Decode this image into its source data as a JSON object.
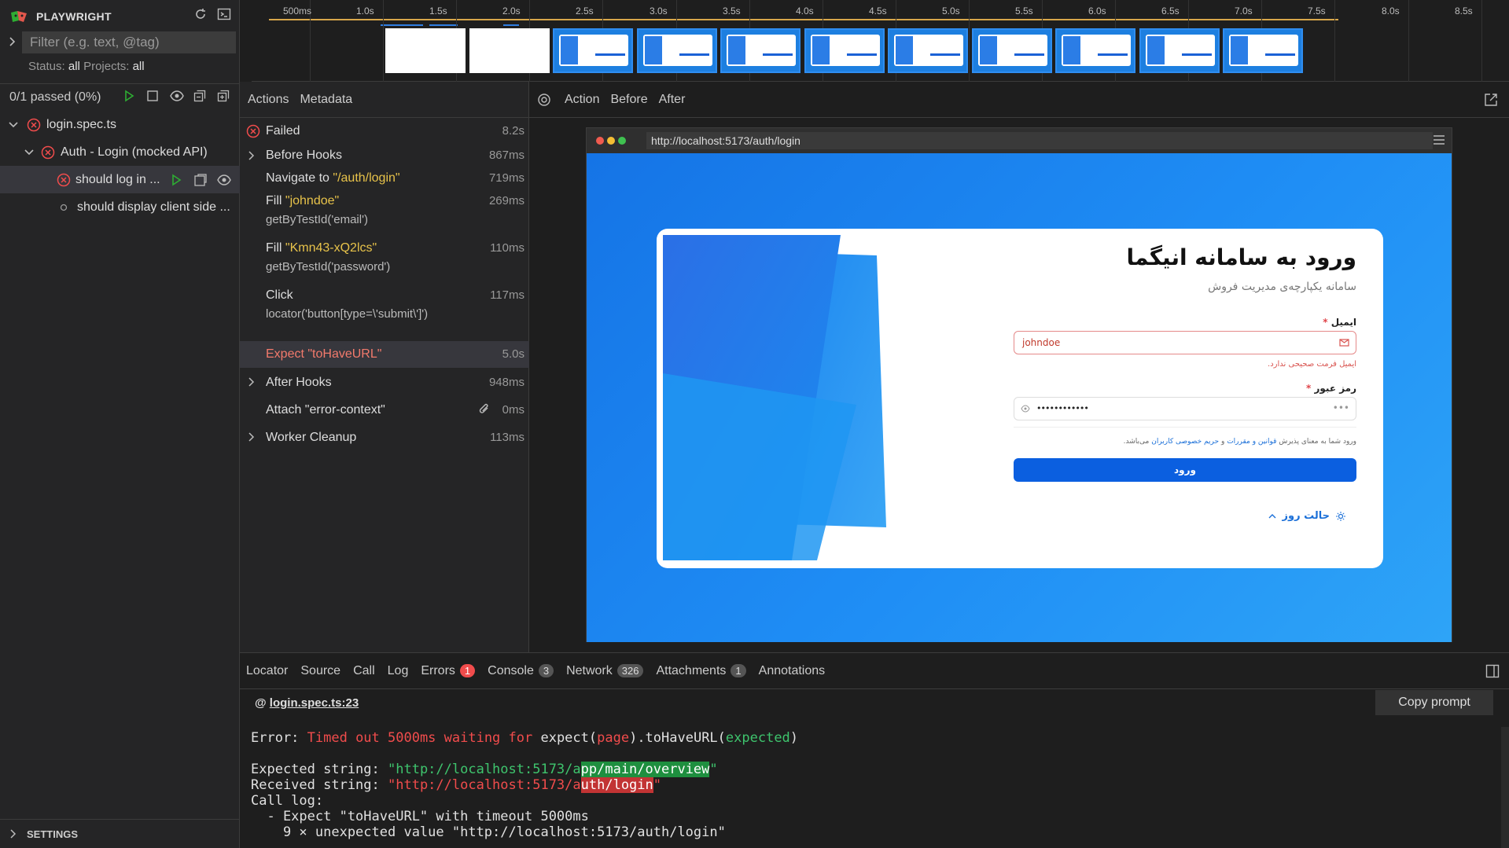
{
  "app": {
    "brand": "PLAYWRIGHT"
  },
  "sidebar": {
    "filter_placeholder": "Filter (e.g. text, @tag)",
    "status_label": "Status:",
    "status_value": "all",
    "projects_label": "Projects:",
    "projects_value": "all",
    "passed": "0/1 passed (0%)",
    "tree": {
      "file": "login.spec.ts",
      "suite": "Auth - Login (mocked API)",
      "test1": "should log in ...",
      "test2": "should display client side ..."
    },
    "settings": "SETTINGS"
  },
  "timeline": {
    "ticks": [
      "500ms",
      "1.0s",
      "1.5s",
      "2.0s",
      "2.5s",
      "3.0s",
      "3.5s",
      "4.0s",
      "4.5s",
      "5.0s",
      "5.5s",
      "6.0s",
      "6.5s",
      "7.0s",
      "7.5s",
      "8.0s",
      "8.5s"
    ]
  },
  "actions_panel": {
    "tabs": [
      "Actions",
      "Metadata"
    ],
    "items": [
      {
        "title": "Failed",
        "duration": "8.2s"
      },
      {
        "title": "Before Hooks",
        "duration": "867ms"
      },
      {
        "title_prefix": "Navigate to ",
        "title_arg": "\"/auth/login\"",
        "duration": "719ms"
      },
      {
        "title_prefix": "Fill ",
        "title_arg": "\"johndoe\"",
        "sub": "getByTestId('email')",
        "duration": "269ms"
      },
      {
        "title_prefix": "Fill ",
        "title_arg": "\"Kmn43-xQ2lcs\"",
        "sub": "getByTestId('password')",
        "duration": "110ms"
      },
      {
        "title": "Click",
        "sub": "locator('button[type=\\'submit\\']')",
        "duration": "117ms"
      },
      {
        "title": "Expect \"toHaveURL\"",
        "duration": "5.0s"
      },
      {
        "title": "After Hooks",
        "duration": "948ms"
      },
      {
        "title": "Attach \"error-context\"",
        "duration": "0ms"
      },
      {
        "title": "Worker Cleanup",
        "duration": "113ms"
      }
    ]
  },
  "snapshot": {
    "tabs": [
      "Action",
      "Before",
      "After"
    ],
    "url": "http://localhost:5173/auth/login",
    "login": {
      "title": "ورود به سامانه انیگما",
      "subtitle": "سامانه یکپارچه‌ی مدیریت فروش",
      "email_label": "ایمیل",
      "email_value": "johndoe",
      "email_error": "ایمیل فرمت صحیحی ندارد.",
      "password_label": "رمز عبور",
      "password_value": "••••••••••••",
      "terms_prefix": "ورود شما به معنای پذیرش",
      "terms_link1": "قوانین و مقررات",
      "terms_and": "و",
      "terms_link2": "حریم خصوصی کاربران",
      "terms_suffix": "می‌باشد.",
      "submit": "ورود",
      "theme": "حالت روز"
    }
  },
  "bottom": {
    "tabs": [
      {
        "label": "Locator"
      },
      {
        "label": "Source"
      },
      {
        "label": "Call"
      },
      {
        "label": "Log"
      },
      {
        "label": "Errors",
        "count": "1"
      },
      {
        "label": "Console",
        "count": "3"
      },
      {
        "label": "Network",
        "count": "326"
      },
      {
        "label": "Attachments",
        "count": "1"
      },
      {
        "label": "Annotations"
      }
    ],
    "copy_prompt": "Copy prompt",
    "location": "login.spec.ts:23",
    "error": {
      "prefix": "Error: ",
      "msg": "Timed out 5000ms waiting for",
      "expect": " expect(",
      "page": "page",
      "mid": ").toHaveURL(",
      "expected": "expected",
      "end": ")",
      "expected_label": "Expected string: ",
      "expected_common": "\"http://localhost:5173/a",
      "expected_diff": "pp/main/overview",
      "received_label": "Received string: ",
      "received_common": "\"http://localhost:5173/a",
      "received_diff": "uth/login",
      "quote": "\"",
      "call_log": "Call log:",
      "log1": "  - Expect \"toHaveURL\" with timeout 5000ms",
      "log2": "    9 × unexpected value \"http://localhost:5173/auth/login\""
    }
  }
}
